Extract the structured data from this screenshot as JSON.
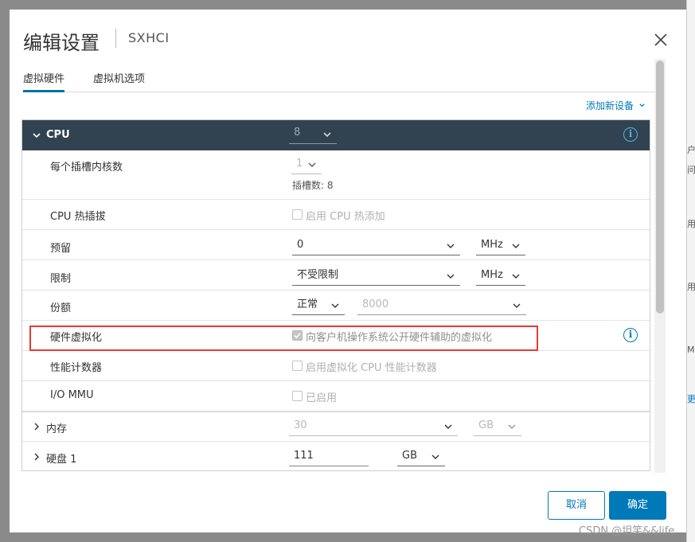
{
  "dialog": {
    "title": "编辑设置",
    "subtitle": "SXHCI"
  },
  "tabs": [
    {
      "label": "虚拟硬件",
      "active": true
    },
    {
      "label": "虚拟机选项",
      "active": false
    }
  ],
  "add_device": "添加新设备",
  "cpu": {
    "label": "CPU",
    "value": "8",
    "cores_per_socket": {
      "label": "每个插槽内核数",
      "value": "1",
      "sockets_text": "插槽数: 8"
    },
    "hot_plug": {
      "label": "CPU 热插拔",
      "checkbox_text": "启用 CPU 热添加",
      "checked": false
    },
    "reservation": {
      "label": "预留",
      "value": "0",
      "unit": "MHz"
    },
    "limit": {
      "label": "限制",
      "value": "不受限制",
      "unit": "MHz"
    },
    "shares": {
      "label": "份额",
      "level": "正常",
      "value": "8000"
    },
    "hw_virtualization": {
      "label": "硬件虚拟化",
      "checkbox_text": "向客户机操作系统公开硬件辅助的虚拟化",
      "checked": true
    },
    "perf_counters": {
      "label": "性能计数器",
      "checkbox_text": "启用虚拟化 CPU 性能计数器",
      "checked": false
    },
    "iommu": {
      "label": "I/O MMU",
      "checkbox_text": "已启用",
      "checked": false
    }
  },
  "memory": {
    "label": "内存",
    "value": "30",
    "unit": "GB"
  },
  "disk": {
    "label": "硬盘 1",
    "value": "111",
    "unit": "GB"
  },
  "buttons": {
    "cancel": "取消",
    "ok": "确定"
  },
  "background": {
    "right_texts": [
      "户用",
      "问:",
      "用",
      "用",
      "MB",
      "更"
    ]
  },
  "watermark": "CSDN @坦笑&&life",
  "colors": {
    "header_bg": "#314351",
    "accent": "#0079b8",
    "highlight": "#e53935"
  }
}
